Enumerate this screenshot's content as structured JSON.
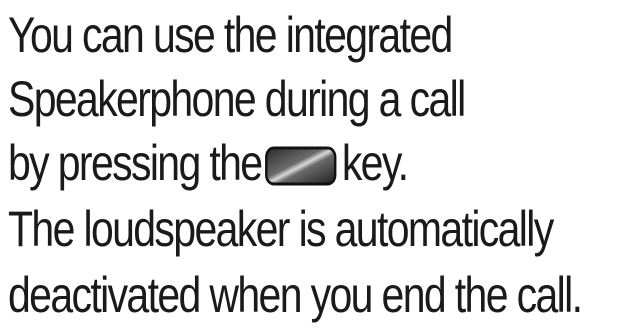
{
  "text": {
    "line1": "You can use the integrated",
    "line2": "Speakerphone during a call",
    "line3_before": "by pressing the",
    "line3_after": "key.",
    "line4": "The loudspeaker is automatically",
    "line5": "deactivated when you end the call."
  },
  "icons": {
    "speakerphone_key": "speakerphone-key-icon"
  }
}
